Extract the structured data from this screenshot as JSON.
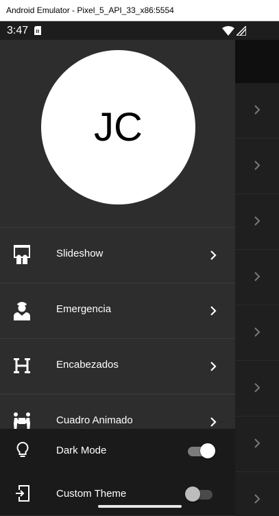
{
  "window": {
    "title": "Android Emulator - Pixel_5_API_33_x86:5554"
  },
  "status_bar": {
    "time": "3:47"
  },
  "drawer": {
    "avatar_initials": "JC",
    "items": [
      {
        "label": "Slideshow",
        "icon": "slideshow-icon"
      },
      {
        "label": "Emergencia",
        "icon": "emergency-person-icon"
      },
      {
        "label": "Encabezados",
        "icon": "heading-icon"
      },
      {
        "label": "Cuadro Animado",
        "icon": "people-carry-box-icon"
      }
    ],
    "options": [
      {
        "label": "Dark Mode",
        "icon": "lightbulb-icon",
        "enabled": true
      },
      {
        "label": "Custom Theme",
        "icon": "phone-login-icon",
        "enabled": false
      }
    ]
  }
}
